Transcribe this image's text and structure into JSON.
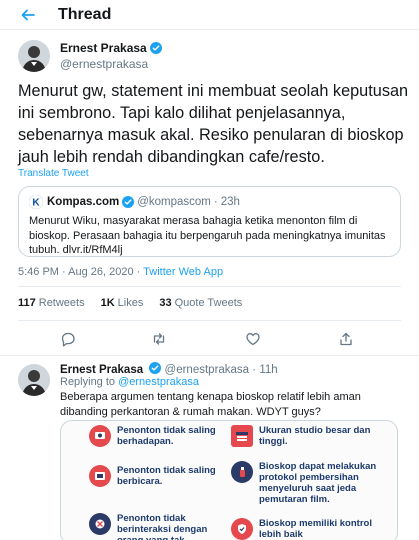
{
  "header": {
    "title": "Thread"
  },
  "main_tweet": {
    "author_name": "Ernest Prakasa",
    "author_handle": "@ernestprakasa",
    "text": "Menurut gw, statement ini membuat seolah keputusan ini sembrono. Tapi kalo dilihat penjelasannya, sebenarnya masuk akal. Resiko penularan di bioskop jauh lebih rendah dibandingkan cafe/resto.",
    "translate_label": "Translate Tweet",
    "quote": {
      "name": "Kompas.com",
      "handle": "@kompascom",
      "separator": "·",
      "time": "23h",
      "text": "Menurut Wiku, masyarakat merasa bahagia ketika menonton film di bioskop. Perasaan bahagia itu berpengaruh pada meningkatnya imunitas tubuh. dlvr.it/RfM4lj"
    },
    "timestamp": "5:46 PM · Aug 26, 2020 · ",
    "source": "Twitter Web App",
    "stats": [
      {
        "count": "117",
        "label": "Retweets"
      },
      {
        "count": "1K",
        "label": "Likes"
      },
      {
        "count": "33",
        "label": "Quote Tweets"
      }
    ]
  },
  "reply_tweet": {
    "author_name": "Ernest Prakasa",
    "author_handle": "@ernestprakasa",
    "separator": "·",
    "time": "11h",
    "replying_prefix": "Replying to ",
    "replying_handle": "@ernestprakasa",
    "text": "Beberapa argumen tentang kenapa bioskop relatif lebih aman dibanding perkantoran & rumah makan. WDYT guys?",
    "infographic": {
      "left": [
        "Penonton tidak saling berhadapan.",
        "Penonton tidak saling berbicara.",
        "Penonton tidak berinteraksi dengan orang yang tak"
      ],
      "right": [
        "Ukuran studio besar dan tinggi.",
        "Bioskop dapat melakukan protokol pembersihan menyeluruh saat jeda pemutaran film.",
        "Bioskop memiliki kontrol lebih baik"
      ]
    }
  },
  "colors": {
    "accent": "#1da1f2",
    "text": "#14171a",
    "secondary": "#657786",
    "info_text": "#1d3a6e",
    "icon_red": "#e5484d",
    "icon_navy": "#2b3a67"
  }
}
